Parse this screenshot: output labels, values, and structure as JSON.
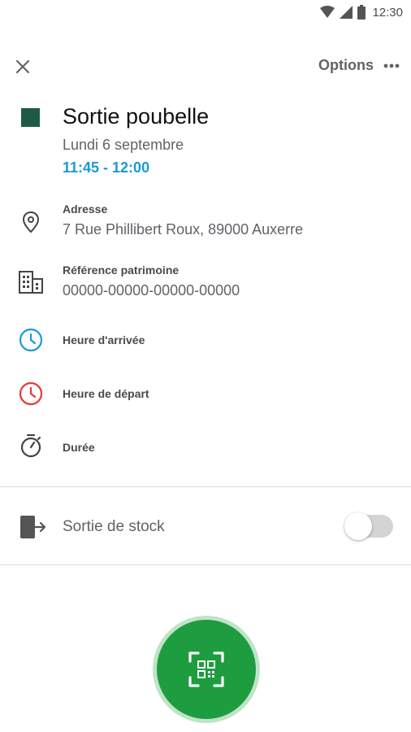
{
  "status_bar": {
    "time": "12:30"
  },
  "toolbar": {
    "options_label": "Options"
  },
  "event": {
    "color": "#1f5a46",
    "title": "Sortie poubelle",
    "date": "Lundi 6 septembre",
    "time_range": "11:45 - 12:00"
  },
  "details": {
    "address": {
      "label": "Adresse",
      "value": "7 Rue Phillibert Roux, 89000 Auxerre",
      "icon": "location-pin-icon"
    },
    "patrimony": {
      "label": "Référence patrimoine",
      "value": "00000-00000-00000-00000",
      "icon": "building-icon"
    },
    "arrival": {
      "label": "Heure d'arrivée",
      "icon": "clock-icon",
      "color": "#1a9ad6"
    },
    "departure": {
      "label": "Heure de départ",
      "icon": "clock-icon",
      "color": "#e53935"
    },
    "duration": {
      "label": "Durée",
      "icon": "stopwatch-icon"
    }
  },
  "stock": {
    "label": "Sortie de stock",
    "enabled": false,
    "icon": "exit-icon"
  },
  "fab": {
    "icon": "qr-scan-icon",
    "color": "#1e9c40"
  }
}
